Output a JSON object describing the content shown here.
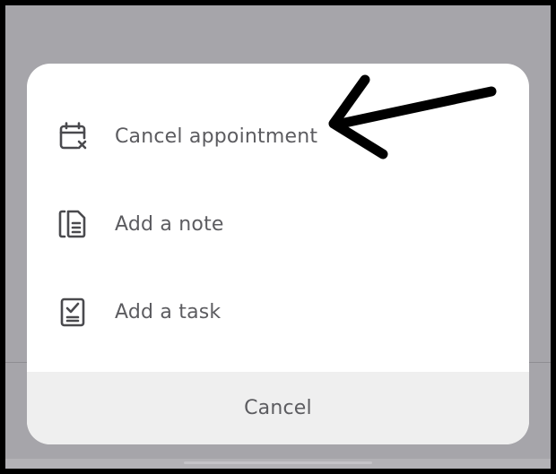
{
  "action_sheet": {
    "items": [
      {
        "label": "Cancel appointment",
        "icon": "calendar-x-icon"
      },
      {
        "label": "Add a note",
        "icon": "note-icon"
      },
      {
        "label": "Add a task",
        "icon": "task-checklist-icon"
      }
    ],
    "cancel_label": "Cancel"
  },
  "annotation": {
    "icon": "arrow-icon",
    "points_to": "Cancel appointment"
  },
  "colors": {
    "backdrop": "#a6a5aa",
    "sheet": "#ffffff",
    "cancel_area": "#efefef",
    "text": "#5c5c60",
    "icon": "#4a4a4e",
    "arrow": "#000000"
  }
}
